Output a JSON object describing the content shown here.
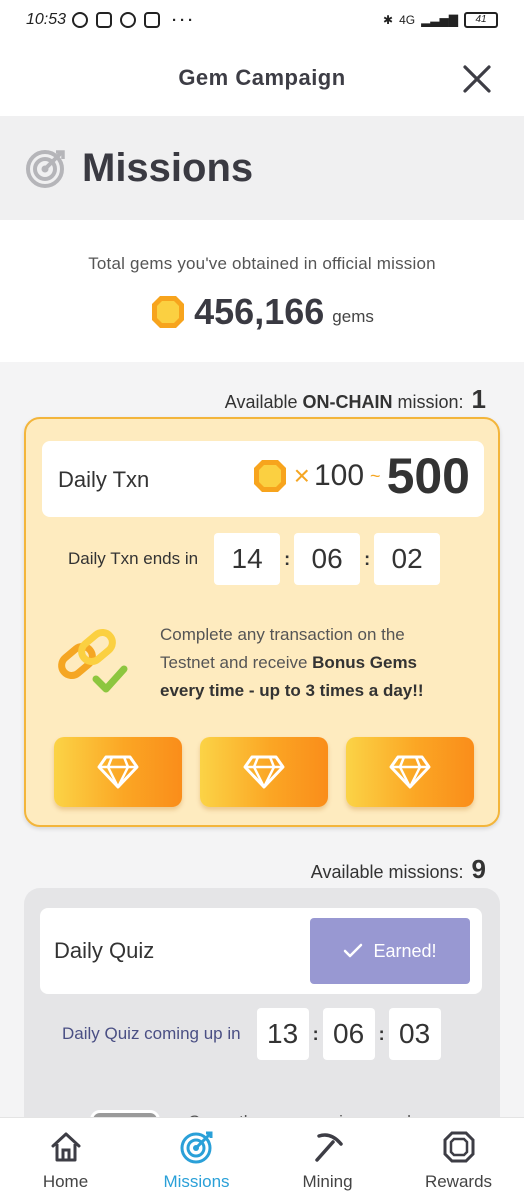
{
  "statusbar": {
    "time": "10:53",
    "dots": "···",
    "network": "4G",
    "battery": "41"
  },
  "header": {
    "title": "Gem Campaign"
  },
  "missions": {
    "title": "Missions"
  },
  "totals": {
    "caption": "Total gems you've obtained in official mission",
    "value": "456,166",
    "unit": "gems"
  },
  "onchain": {
    "label_prefix": "Available ",
    "label_bold": "ON-CHAIN",
    "label_suffix": " mission:",
    "count": "1",
    "name": "Daily Txn",
    "reward_x": "×",
    "reward_min": "100",
    "reward_tilde": "~",
    "reward_max": "500",
    "timer_label": "Daily Txn ends in",
    "timer": [
      "14",
      "06",
      "02"
    ],
    "timer_sep": ":",
    "desc_1": "Complete any transaction on the Testnet and receive ",
    "desc_bold": "Bonus Gems every time - up to 3 times a day!!"
  },
  "available": {
    "label": "Available missions:",
    "count": "9"
  },
  "quiz": {
    "name": "Daily Quiz",
    "earned_label": "Earned!",
    "timer_label": "Daily Quiz coming up in",
    "timer": [
      "13",
      "06",
      "03"
    ],
    "timer_sep": ":",
    "desc": "Correctly answer quizzes and"
  },
  "nav": {
    "items": [
      {
        "label": "Home",
        "icon": "home-icon"
      },
      {
        "label": "Missions",
        "icon": "target-icon"
      },
      {
        "label": "Mining",
        "icon": "pickaxe-icon"
      },
      {
        "label": "Rewards",
        "icon": "gem-icon"
      }
    ],
    "active": "Missions",
    "active_color": "#2aa0d8"
  },
  "colors": {
    "accent_orange": "#f5a623",
    "card_bg": "#feebbf",
    "earned_bg": "#9898d2"
  }
}
